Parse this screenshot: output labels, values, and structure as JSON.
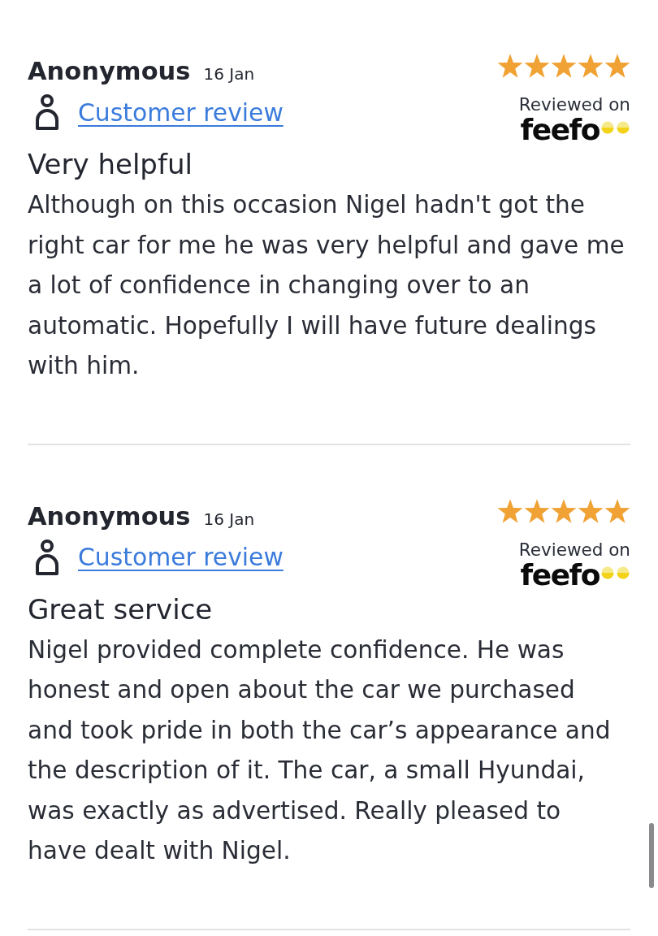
{
  "reviews": [
    {
      "author": "Anonymous",
      "date": "16 Jan",
      "link": "Customer review",
      "stars": 5,
      "badge_label": "Reviewed on",
      "badge_brand": "feefo",
      "title": "Very helpful",
      "body": "Although on this occasion Nigel hadn't got the right car for me he was very helpful and gave me a lot of confidence in changing over to an automatic. Hopefully I will have future dealings with him."
    },
    {
      "author": "Anonymous",
      "date": "16 Jan",
      "link": "Customer review",
      "stars": 5,
      "badge_label": "Reviewed on",
      "badge_brand": "feefo",
      "title": "Great service",
      "body": "Nigel provided complete confidence. He was honest and open about the car we purchased and took pride in both the car’s appearance and the description of it. The car, a small Hyundai, was exactly as advertised. Really pleased to have dealt with Nigel."
    }
  ]
}
